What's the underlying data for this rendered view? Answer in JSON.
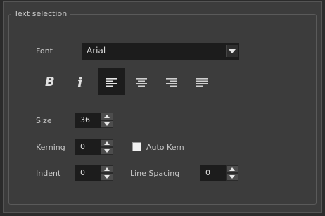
{
  "panel": {
    "group_title": "Text selection",
    "font_label": "Font",
    "font_value": "Arial",
    "size_label": "Size",
    "size_value": "36",
    "kerning_label": "Kerning",
    "kerning_value": "0",
    "auto_kern_label": "Auto Kern",
    "auto_kern_checked": false,
    "indent_label": "Indent",
    "indent_value": "0",
    "line_spacing_label": "Line Spacing",
    "line_spacing_value": "0"
  },
  "format_buttons": {
    "bold_glyph": "B",
    "italic_glyph": "i",
    "active_alignment": "left"
  },
  "icons": [
    "dropdown-arrow-icon",
    "align-left-icon",
    "align-center-icon",
    "align-right-icon",
    "justify-icon",
    "spin-up-icon",
    "spin-down-icon"
  ],
  "colors": {
    "panel_bg": "#3c3c3c",
    "field_bg": "#1c1c1c",
    "text": "#c8c8c8"
  }
}
